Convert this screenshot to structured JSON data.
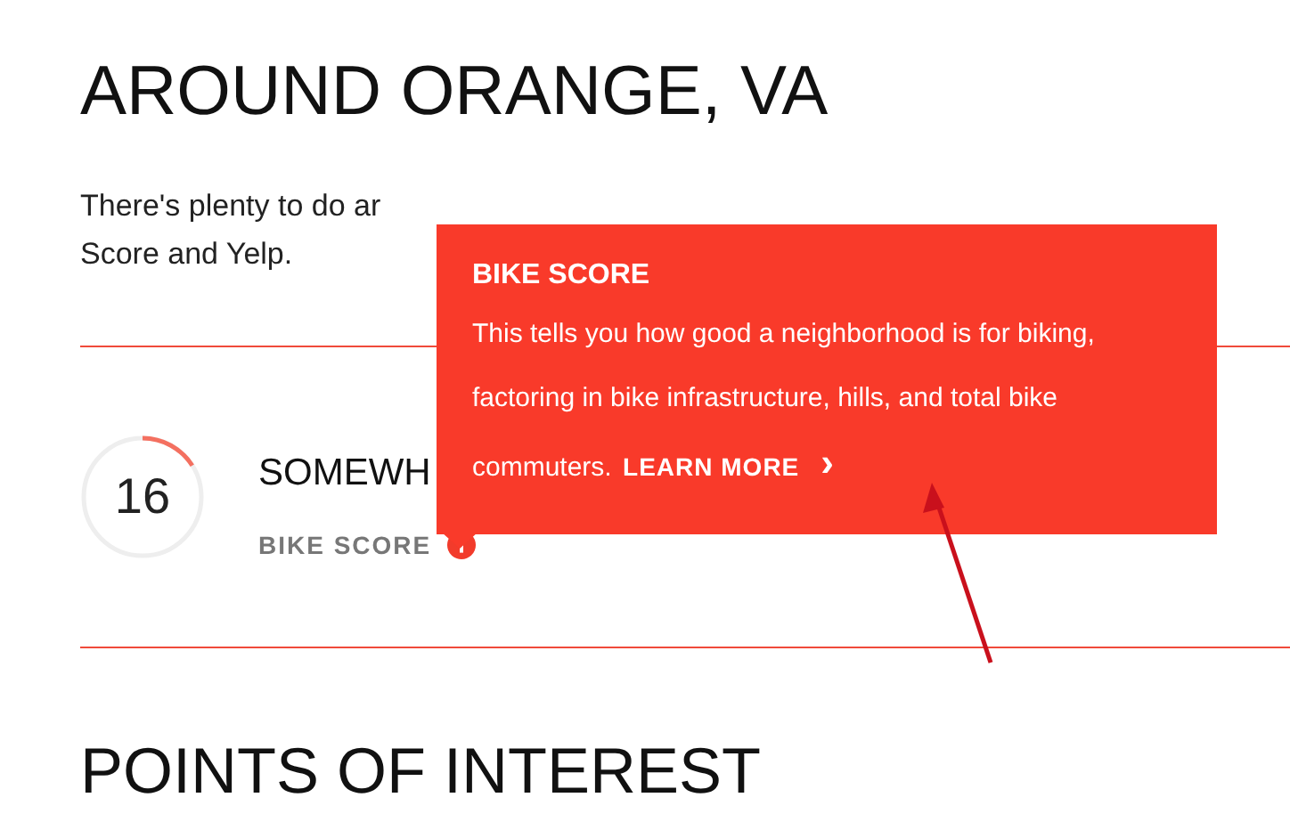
{
  "heading": "AROUND ORANGE, VA",
  "intro": [
    "There's plenty to do ar",
    "Score and Yelp."
  ],
  "score": {
    "value": "16",
    "level": 0.16,
    "rating": "SOMEWH",
    "label": "BIKE SCORE"
  },
  "tooltip": {
    "title": "BIKE SCORE",
    "body": "This tells you how good a neighborhood is for biking, factoring in bike infrastructure, hills, and total bike commuters.",
    "link": "LEARN MORE",
    "chevron": "›"
  },
  "next_heading": "POINTS OF INTEREST"
}
